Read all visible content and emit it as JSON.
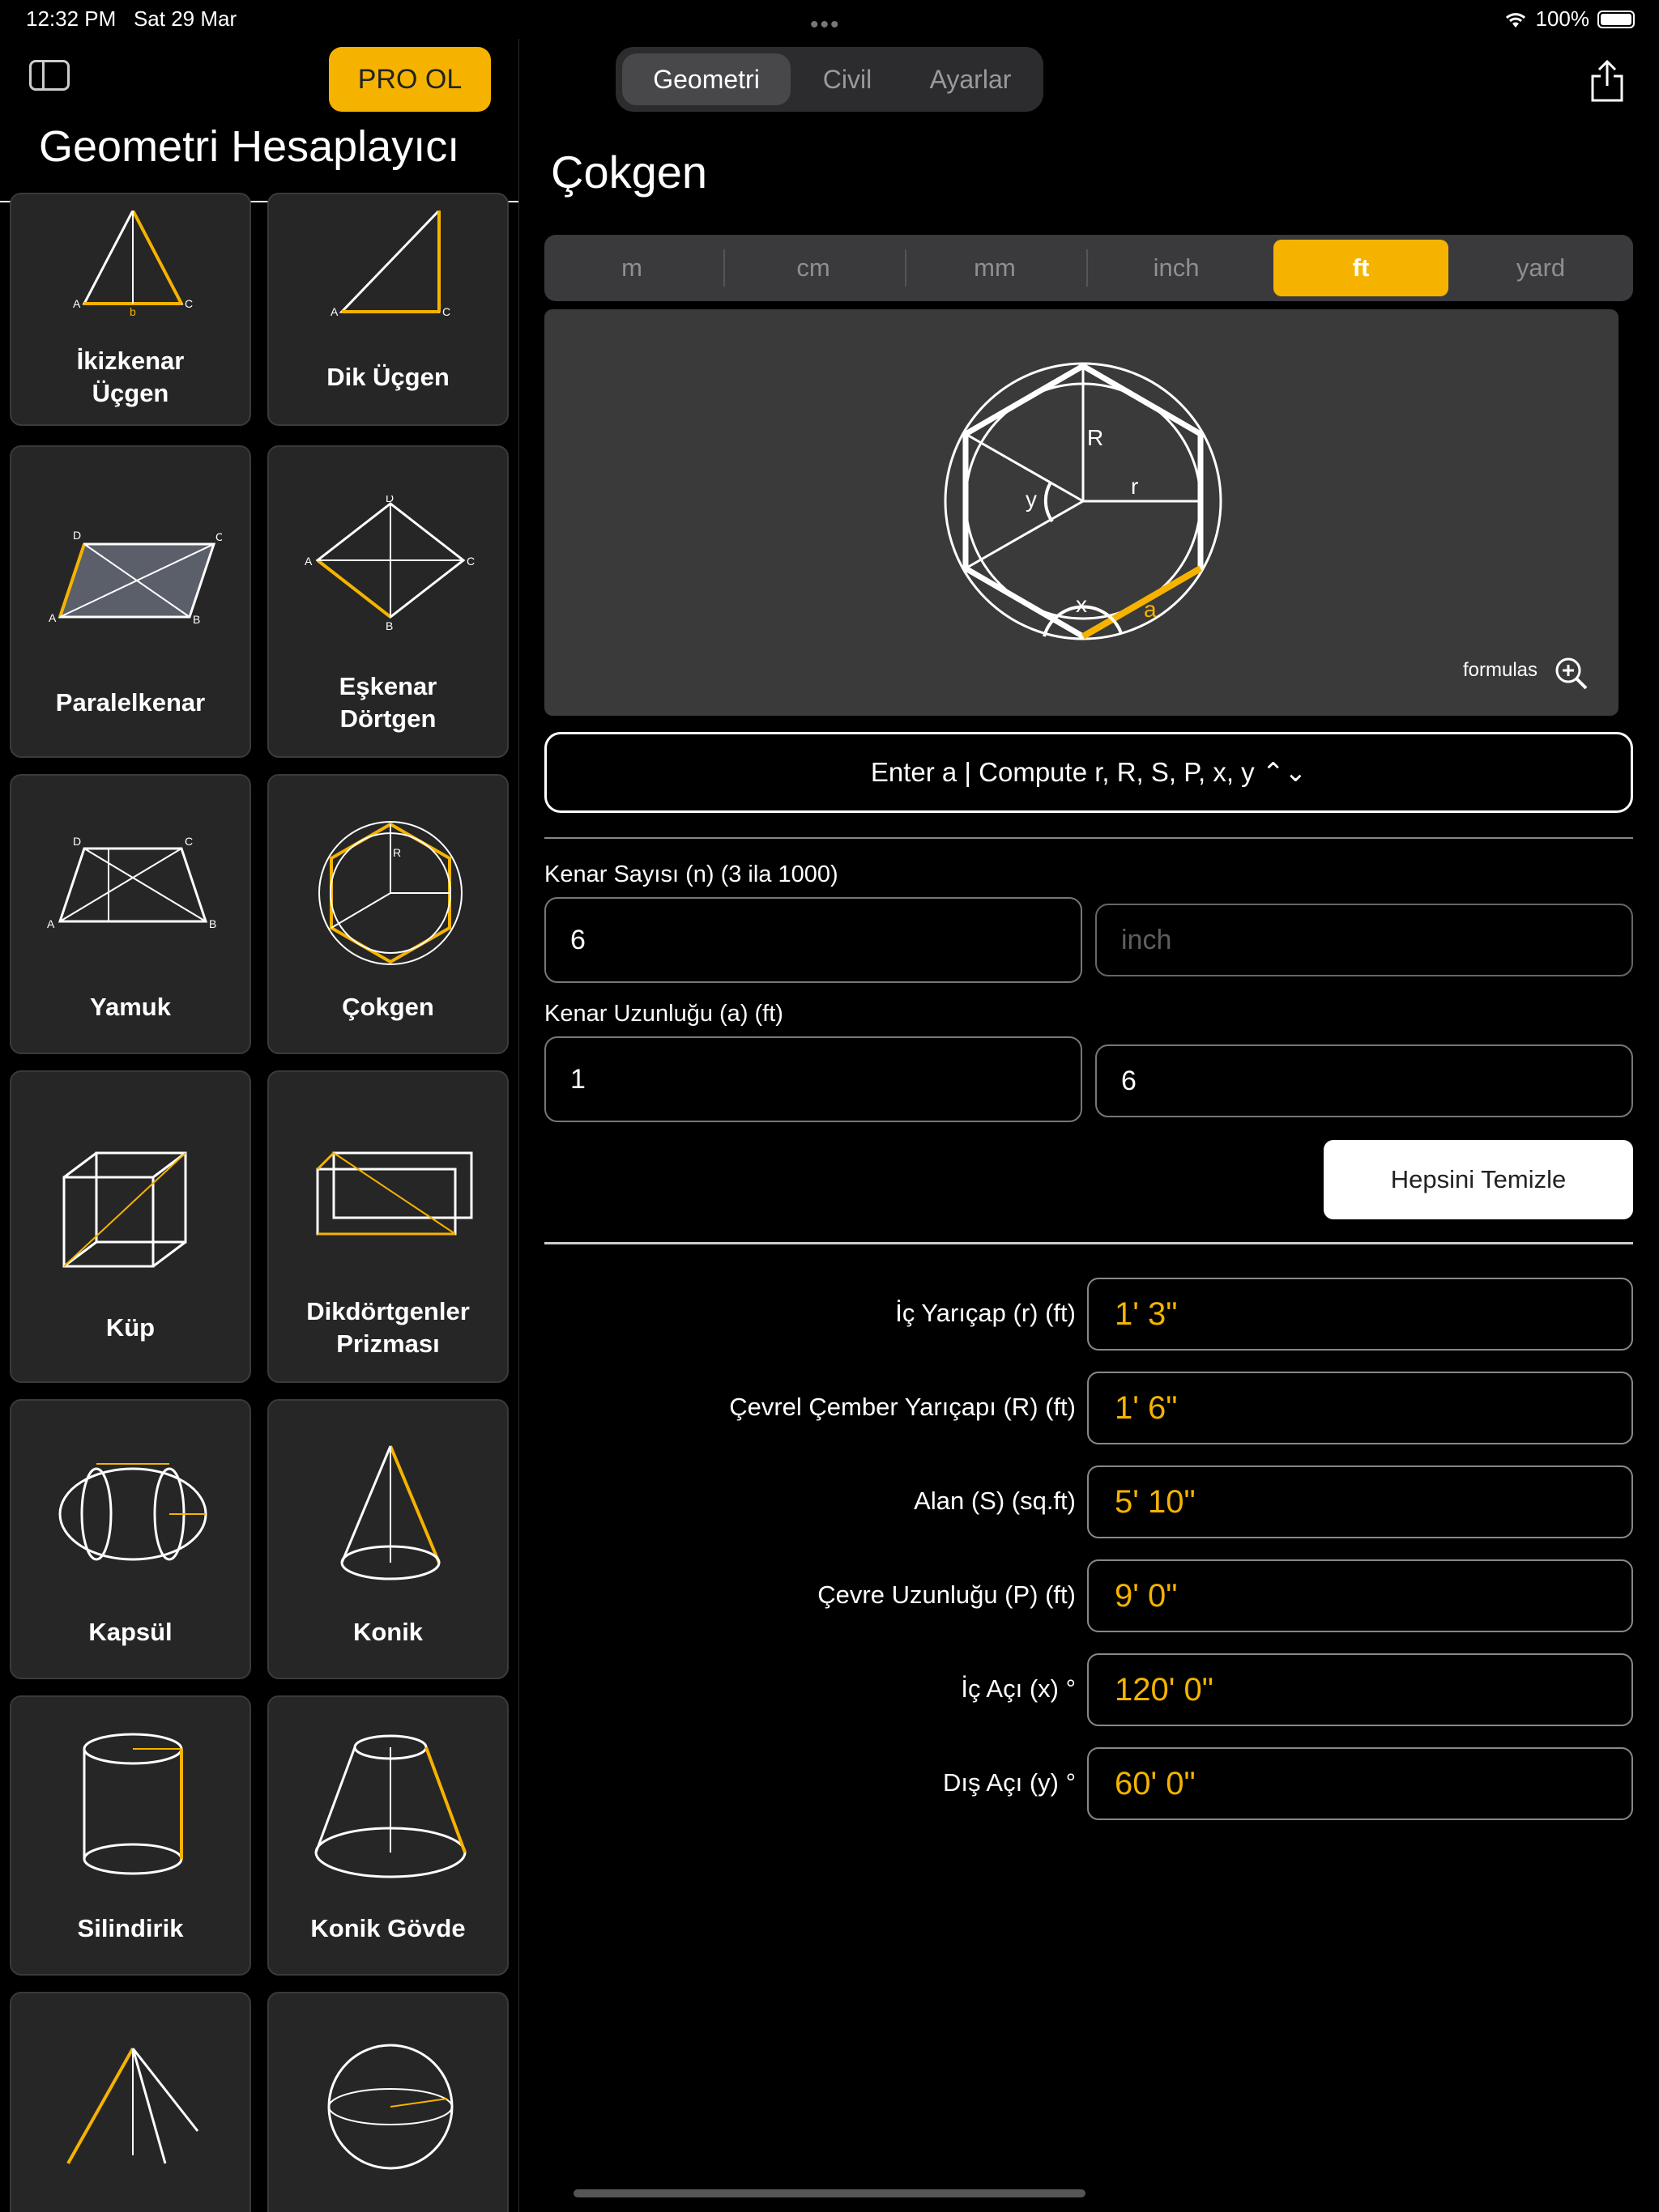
{
  "status": {
    "time": "12:32 PM",
    "date": "Sat 29 Mar",
    "battery": "100%"
  },
  "sidebar": {
    "pro_label": "PRO OL",
    "title": "Geometri Hesaplayıcı",
    "cards": [
      {
        "label": "İkizkenar Üçgen"
      },
      {
        "label": "Dik Üçgen"
      },
      {
        "label": "Paralelkenar"
      },
      {
        "label": "Eşkenar Dörtgen"
      },
      {
        "label": "Yamuk"
      },
      {
        "label": "Çokgen"
      },
      {
        "label": "Küp"
      },
      {
        "label": "Dikdörtgenler Prizması"
      },
      {
        "label": "Kapsül"
      },
      {
        "label": "Konik"
      },
      {
        "label": "Silindirik"
      },
      {
        "label": "Konik Gövde"
      }
    ]
  },
  "tabs": {
    "geometry": "Geometri",
    "civil": "Civil",
    "settings": "Ayarlar"
  },
  "page_title": "Çokgen",
  "units": [
    "m",
    "cm",
    "mm",
    "inch",
    "ft",
    "yard"
  ],
  "selected_unit": "ft",
  "diagram": {
    "formulas_label": "formulas",
    "labels": {
      "R": "R",
      "r": "r",
      "y": "y",
      "x": "x",
      "a": "a"
    }
  },
  "mode_label": "Enter a | Compute r, R, S, P, x, y ⌃⌄",
  "inputs": {
    "n_label": "Kenar Sayısı (n)  (3 ila 1000)",
    "n_value": "6",
    "n_unit_placeholder": "inch",
    "a_label": "Kenar Uzunluğu (a)  (ft)",
    "a_value": "1",
    "a_second": "6"
  },
  "clear_label": "Hepsini Temizle",
  "results": [
    {
      "label": "İç Yarıçap (r) (ft)",
      "value": "1' 3\""
    },
    {
      "label": "Çevrel Çember Yarıçapı (R) (ft)",
      "value": "1' 6\""
    },
    {
      "label": "Alan (S) (sq.ft)",
      "value": "5' 10\""
    },
    {
      "label": "Çevre Uzunluğu (P) (ft)",
      "value": "9' 0\""
    },
    {
      "label": "İç Açı (x) °",
      "value": "120' 0\""
    },
    {
      "label": "Dış Açı (y) °",
      "value": "60' 0\""
    }
  ],
  "colors": {
    "accent": "#f5b300",
    "card": "#262626",
    "panel": "#3a3a3a"
  }
}
